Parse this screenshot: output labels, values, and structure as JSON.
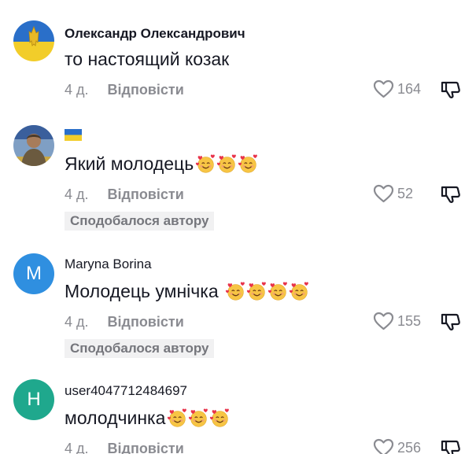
{
  "comments": [
    {
      "username": "Олександр Олександрович",
      "text": "то настоящий козак",
      "emoji_count": 0,
      "time": "4 д.",
      "reply_label": "Відповісти",
      "likes": "164",
      "liked_by_author_label": "",
      "avatar_type": "ukraine-flag-trident"
    },
    {
      "username": "🇺🇦",
      "text": "Який молодець",
      "emoji_count": 3,
      "emoji_name": "smiling-face-with-hearts",
      "time": "4 д.",
      "reply_label": "Відповісти",
      "likes": "52",
      "liked_by_author_label": "Сподобалося автору",
      "avatar_type": "photo"
    },
    {
      "username": "Maryna Borina",
      "text": "Молодець умнічка ",
      "emoji_count": 4,
      "emoji_name": "smiling-face-with-hearts",
      "time": "4 д.",
      "reply_label": "Відповісти",
      "likes": "155",
      "liked_by_author_label": "Сподобалося автору",
      "avatar_type": "letter",
      "avatar_letter": "M",
      "avatar_color": "#2f8fe0"
    },
    {
      "username": "user4047712484697",
      "text": "молодчинка",
      "emoji_count": 3,
      "emoji_name": "smiling-face-with-hearts",
      "time": "4 д.",
      "reply_label": "Відповісти",
      "likes": "256",
      "liked_by_author_label": "",
      "avatar_type": "letter",
      "avatar_letter": "H",
      "avatar_color": "#1fa88d"
    }
  ],
  "colors": {
    "text_primary": "#161823",
    "text_secondary": "#8a8b91",
    "badge_bg": "#f1f1f2"
  }
}
